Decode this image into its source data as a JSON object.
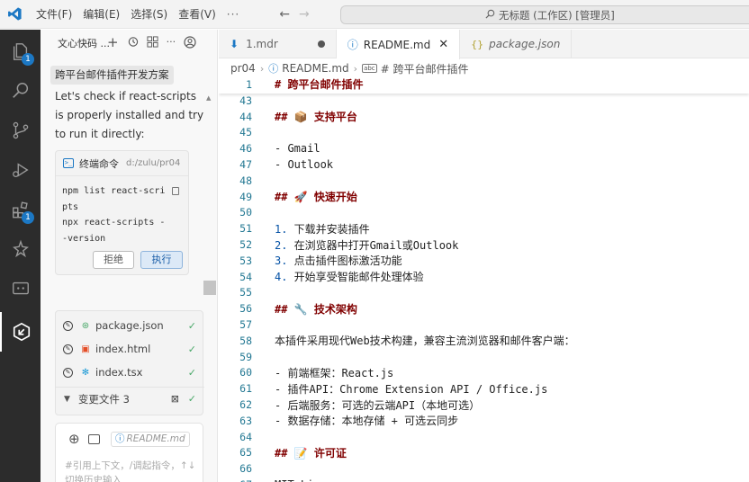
{
  "menu": [
    "文件(F)",
    "编辑(E)",
    "选择(S)",
    "查看(V)"
  ],
  "menu_more": "···",
  "search": {
    "text": "无标题 (工作区) [管理员]"
  },
  "activity_badges": {
    "explorer": "1",
    "extensions": "1"
  },
  "chat": {
    "header_title": "文心快码 ...",
    "session_title": "跨平台邮件插件开发方案",
    "message": "Let's check if react-scripts is properly installed and try to run it directly:",
    "terminal": {
      "title": "终端命令",
      "path": "d:/zulu/pr04",
      "code": "npm list react-scripts\nnpx react-scripts --version",
      "reject_label": "拒绝",
      "run_label": "执行"
    },
    "files": [
      {
        "name": "package.json",
        "icon": "package-icon"
      },
      {
        "name": "index.html",
        "icon": "html-icon"
      },
      {
        "name": "index.tsx",
        "icon": "react-icon"
      }
    ],
    "changed_files": "变更文件 3",
    "input": {
      "context_file": "README.md",
      "placeholder": "#引用上下文，/调起指令，↑↓切换历史输入"
    }
  },
  "tabs": [
    {
      "label": "1.mdr",
      "state": ""
    },
    {
      "label": "README.md",
      "state": "active"
    },
    {
      "label": "package.json",
      "state": "italic"
    }
  ],
  "breadcrumb": {
    "folder": "pr04",
    "file": "README.md",
    "symbol": "# 跨平台邮件插件"
  },
  "editor": {
    "sticky": {
      "num": "1",
      "text": "# 跨平台邮件插件"
    },
    "lines": [
      {
        "num": "43",
        "text": ""
      },
      {
        "num": "44",
        "text": "## 📦 支持平台"
      },
      {
        "num": "45",
        "text": ""
      },
      {
        "num": "46",
        "text": "- Gmail"
      },
      {
        "num": "47",
        "text": "- Outlook"
      },
      {
        "num": "48",
        "text": ""
      },
      {
        "num": "49",
        "text": "## 🚀 快速开始"
      },
      {
        "num": "50",
        "text": ""
      },
      {
        "num": "51",
        "text": "1. 下载并安装插件"
      },
      {
        "num": "52",
        "text": "2. 在浏览器中打开Gmail或Outlook"
      },
      {
        "num": "53",
        "text": "3. 点击插件图标激活功能"
      },
      {
        "num": "54",
        "text": "4. 开始享受智能邮件处理体验"
      },
      {
        "num": "55",
        "text": ""
      },
      {
        "num": "56",
        "text": "## 🔧 技术架构"
      },
      {
        "num": "57",
        "text": ""
      },
      {
        "num": "58",
        "text": "本插件采用现代Web技术构建，兼容主流浏览器和邮件客户端："
      },
      {
        "num": "59",
        "text": ""
      },
      {
        "num": "60",
        "text": "- 前端框架：React.js"
      },
      {
        "num": "61",
        "text": "- 插件API：Chrome Extension API / Office.js"
      },
      {
        "num": "62",
        "text": "- 后端服务：可选的云端API（本地可选）"
      },
      {
        "num": "63",
        "text": "- 数据存储：本地存储 + 可选云同步"
      },
      {
        "num": "64",
        "text": ""
      },
      {
        "num": "65",
        "text": "## 📝 许可证"
      },
      {
        "num": "66",
        "text": ""
      },
      {
        "num": "67",
        "text": "MIT License"
      }
    ]
  }
}
